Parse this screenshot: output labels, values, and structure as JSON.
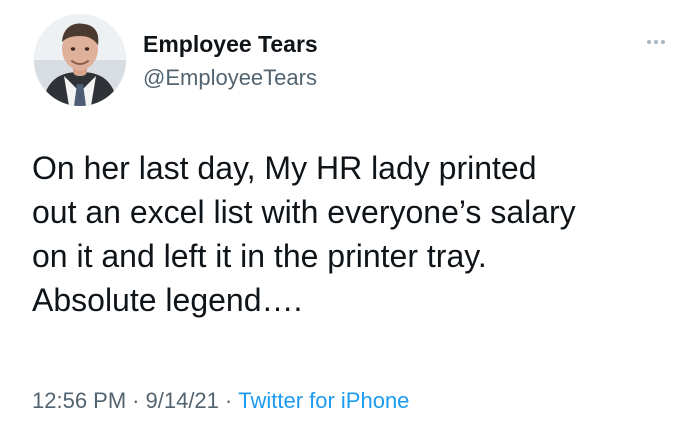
{
  "author": {
    "display_name": "Employee Tears",
    "handle": "@EmployeeTears",
    "avatar_icon": "profile-photo-man-in-suit"
  },
  "tweet": {
    "text": "On her last day, My HR lady printed\nout an excel list with everyone’s salary\non it and left it in the printer tray.\nAbsolute legend….",
    "time": "12:56 PM",
    "date": "9/14/21",
    "source": "Twitter for iPhone",
    "separator": "·"
  },
  "icons": {
    "more": "more-horizontal-icon"
  },
  "colors": {
    "text": "#0f1419",
    "muted": "#536471",
    "link": "#1d9bf0",
    "more_dots": "#aab8c2"
  }
}
